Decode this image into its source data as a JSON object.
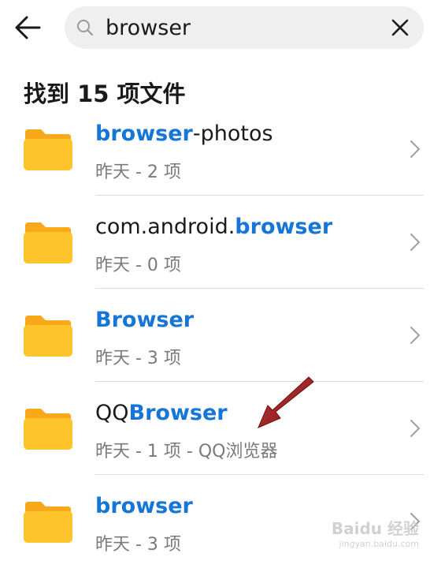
{
  "search": {
    "query": "browser",
    "back_icon": "arrow-left-icon",
    "search_icon": "search-icon",
    "clear_icon": "close-icon"
  },
  "results": {
    "header": "找到 15 项文件",
    "items": [
      {
        "name_parts": [
          {
            "text": "browser",
            "hl": true
          },
          {
            "text": "-photos",
            "hl": false
          }
        ],
        "meta": "昨天 - 2 项"
      },
      {
        "name_parts": [
          {
            "text": "com.android.",
            "hl": false
          },
          {
            "text": "browser",
            "hl": true
          }
        ],
        "meta": "昨天 - 0 项"
      },
      {
        "name_parts": [
          {
            "text": "Browser",
            "hl": true
          }
        ],
        "meta": "昨天 - 3 项"
      },
      {
        "name_parts": [
          {
            "text": "QQ",
            "hl": false
          },
          {
            "text": "Browser",
            "hl": true
          }
        ],
        "meta": "昨天 - 1 项 - QQ浏览器"
      },
      {
        "name_parts": [
          {
            "text": "browser",
            "hl": true
          }
        ],
        "meta": "昨天 - 3 项"
      }
    ]
  },
  "colors": {
    "highlight": "#1576d8",
    "folder_back": "#f7a81b",
    "folder_front": "#fdc42c",
    "annotation_arrow": "#a02020"
  },
  "watermark": {
    "logo": "Baidu 经验",
    "sub": "jingyan.baidu.com"
  }
}
